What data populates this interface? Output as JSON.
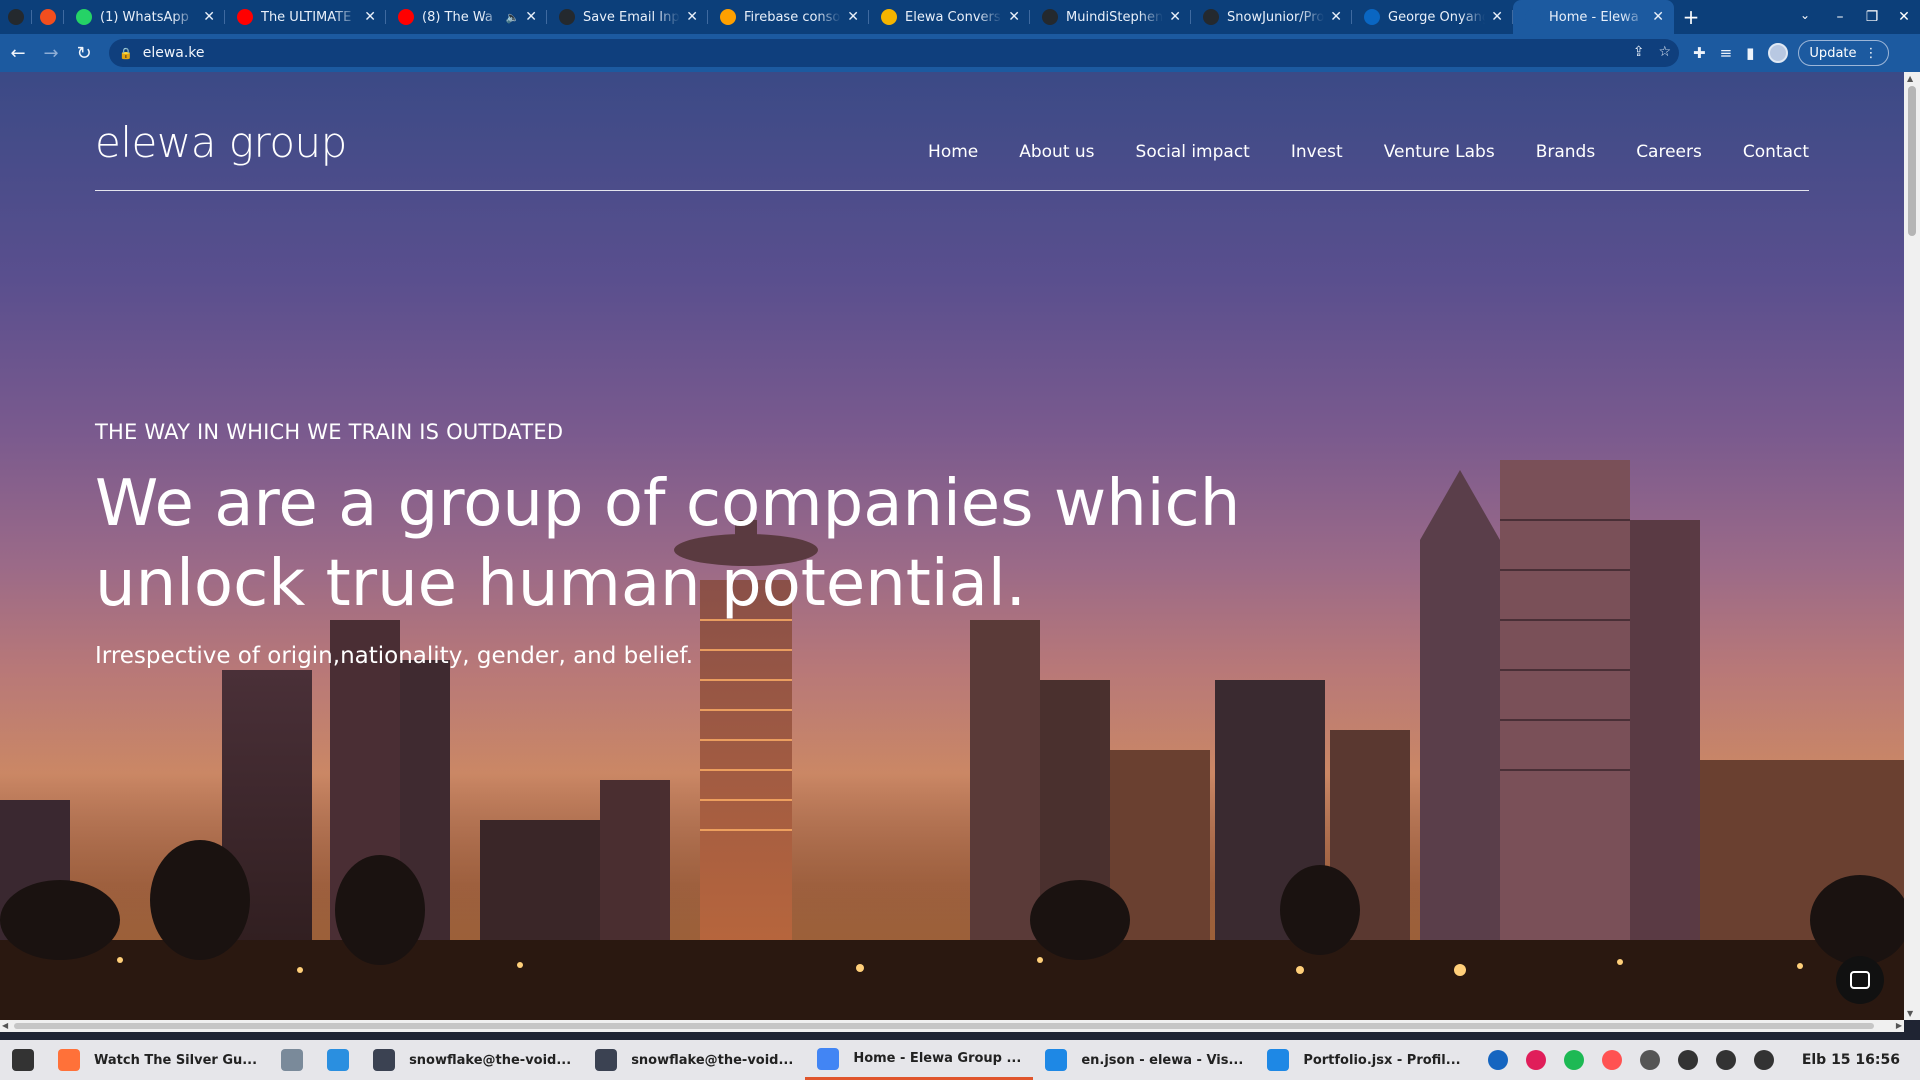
{
  "browser": {
    "tabs": [
      {
        "label": "",
        "icon": "github-icon",
        "color": "#24292e",
        "pinned": true
      },
      {
        "label": "",
        "icon": "figma-icon",
        "color": "#f24e1e",
        "pinned": true
      },
      {
        "label": "(1) WhatsApp",
        "icon": "whatsapp-icon",
        "color": "#25d366"
      },
      {
        "label": "The ULTIMATE",
        "icon": "youtube-icon",
        "color": "#ff0000"
      },
      {
        "label": "(8) The Wa",
        "icon": "youtube-icon",
        "color": "#ff0000",
        "muted": true
      },
      {
        "label": "Save Email Inpu",
        "icon": "github-icon",
        "color": "#24292e"
      },
      {
        "label": "Firebase conso",
        "icon": "firebase-icon",
        "color": "#ffa000"
      },
      {
        "label": "Elewa Convers",
        "icon": "elewa-icon",
        "color": "#f5b400"
      },
      {
        "label": "MuindiStephen",
        "icon": "github-icon",
        "color": "#24292e"
      },
      {
        "label": "SnowJunior/Pro",
        "icon": "github-icon",
        "color": "#24292e"
      },
      {
        "label": "George Onyang",
        "icon": "linkedin-icon",
        "color": "#0a66c2"
      },
      {
        "label": "Home - Elewa",
        "icon": "elewa-icon",
        "color": "#1c5aa0",
        "active": true
      }
    ],
    "url": "elewa.ke",
    "update_label": "Update"
  },
  "site": {
    "logo": "elewa group",
    "nav": [
      "Home",
      "About us",
      "Social impact",
      "Invest",
      "Venture Labs",
      "Brands",
      "Careers",
      "Contact"
    ],
    "hero": {
      "eyebrow": "THE WAY IN WHICH WE TRAIN IS OUTDATED",
      "headline_line1": "We are a group of companies which",
      "headline_line2": "unlock true human potential.",
      "subline": "Irrespective of origin,nationality, gender, and belief."
    }
  },
  "taskbar": {
    "items": [
      {
        "label": "",
        "icon": "zorin-menu-icon",
        "color": "#333"
      },
      {
        "label": "Watch The Silver Gu...",
        "icon": "firefox-icon",
        "color": "#ff7139"
      },
      {
        "label": "",
        "icon": "files-icon",
        "color": "#7a8a9a"
      },
      {
        "label": "",
        "icon": "store-icon",
        "color": "#2a8fe0"
      },
      {
        "label": "snowflake@the-void...",
        "icon": "terminal-icon",
        "color": "#3b4252"
      },
      {
        "label": "snowflake@the-void...",
        "icon": "terminal-icon",
        "color": "#3b4252"
      },
      {
        "label": "Home - Elewa Group ...",
        "icon": "chrome-icon",
        "color": "#4285f4",
        "active": true
      },
      {
        "label": "en.json - elewa - Vis...",
        "icon": "vscode-icon",
        "color": "#1e88e5"
      },
      {
        "label": "Portfolio.jsx - Profil...",
        "icon": "vscode-icon",
        "color": "#1e88e5"
      }
    ],
    "tray": [
      {
        "icon": "app-icon",
        "color": "#1565c0"
      },
      {
        "icon": "slack-icon",
        "color": "#e01e5a"
      },
      {
        "icon": "spotify-icon",
        "color": "#1db954"
      },
      {
        "icon": "recorder-icon",
        "color": "#ff5252"
      },
      {
        "icon": "network-icon",
        "color": "#555"
      },
      {
        "icon": "wifi-icon",
        "color": "#333"
      },
      {
        "icon": "volume-icon",
        "color": "#333"
      },
      {
        "icon": "battery-icon",
        "color": "#333"
      }
    ],
    "clock": "Elb 15  16:56"
  }
}
